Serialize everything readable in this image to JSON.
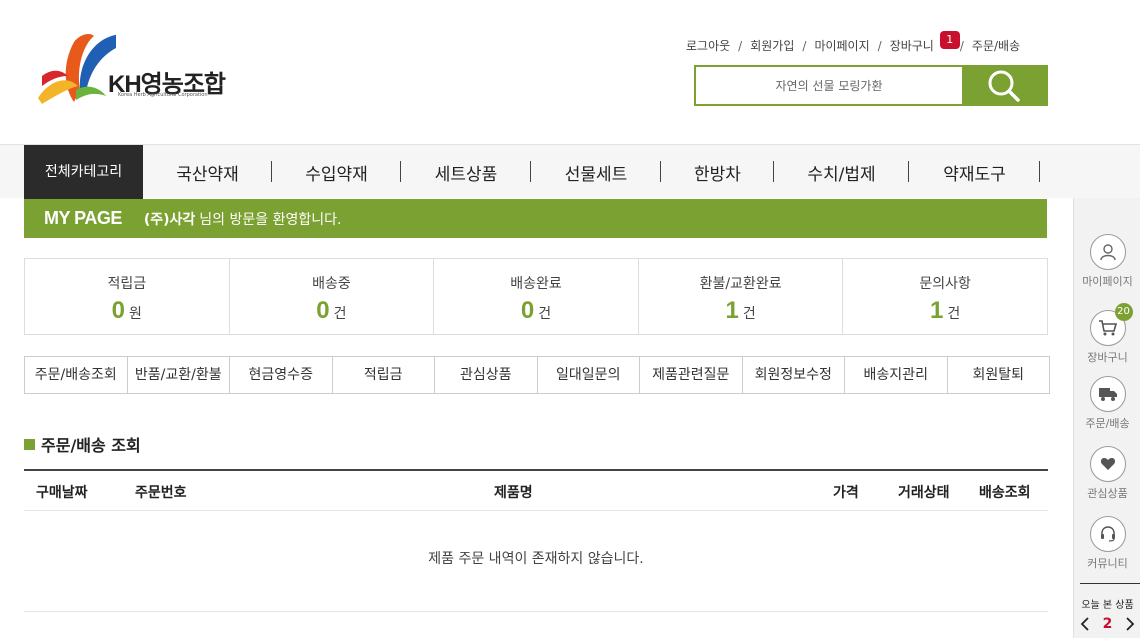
{
  "brand": {
    "name": "KH영농조합",
    "subtitle": "Korea Herb Agricultural Corporation"
  },
  "top_links": {
    "logout": "로그아웃",
    "join": "회원가입",
    "mypage": "마이페이지",
    "cart": "장바구니",
    "cart_count": "1",
    "orders": "주문/배송",
    "separator": "/"
  },
  "search": {
    "placeholder": "자연의 선물 모링가환"
  },
  "nav": {
    "all_categories": "전체카테고리",
    "items": [
      "국산약재",
      "수입약재",
      "세트상품",
      "선물세트",
      "한방차",
      "수치/법제",
      "약재도구"
    ]
  },
  "mypage_bar": {
    "title": "MY PAGE",
    "user": "(주)사각",
    "welcome": "님의 방문을 환영합니다."
  },
  "stats": [
    {
      "label": "적립금",
      "value": "0",
      "unit": "원"
    },
    {
      "label": "배송중",
      "value": "0",
      "unit": "건"
    },
    {
      "label": "배송완료",
      "value": "0",
      "unit": "건"
    },
    {
      "label": "환불/교환완료",
      "value": "1",
      "unit": "건"
    },
    {
      "label": "문의사항",
      "value": "1",
      "unit": "건"
    }
  ],
  "tabs": [
    "주문/배송조회",
    "반품/교환/환불",
    "현금영수증",
    "적립금",
    "관심상품",
    "일대일문의",
    "제품관련질문",
    "회원정보수정",
    "배송지관리",
    "회원탈퇴"
  ],
  "section": {
    "title": "주문/배송 조회"
  },
  "table": {
    "headers": {
      "date": "구매날짜",
      "order_no": "주문번호",
      "product": "제품명",
      "price": "가격",
      "status": "거래상태",
      "tracking": "배송조회"
    },
    "empty_message": "제품 주문 내역이 존재하지 않습니다."
  },
  "sidebar": {
    "mypage": "마이페이지",
    "cart": "장바구니",
    "cart_count": "20",
    "orders": "주문/배송",
    "wishlist": "관심상품",
    "community": "커뮤니티",
    "recent_title": "오늘 본 상품",
    "recent_page": "2"
  },
  "colors": {
    "accent": "#7ba132",
    "dark": "#2b2b2b",
    "badge": "#c8102e"
  }
}
